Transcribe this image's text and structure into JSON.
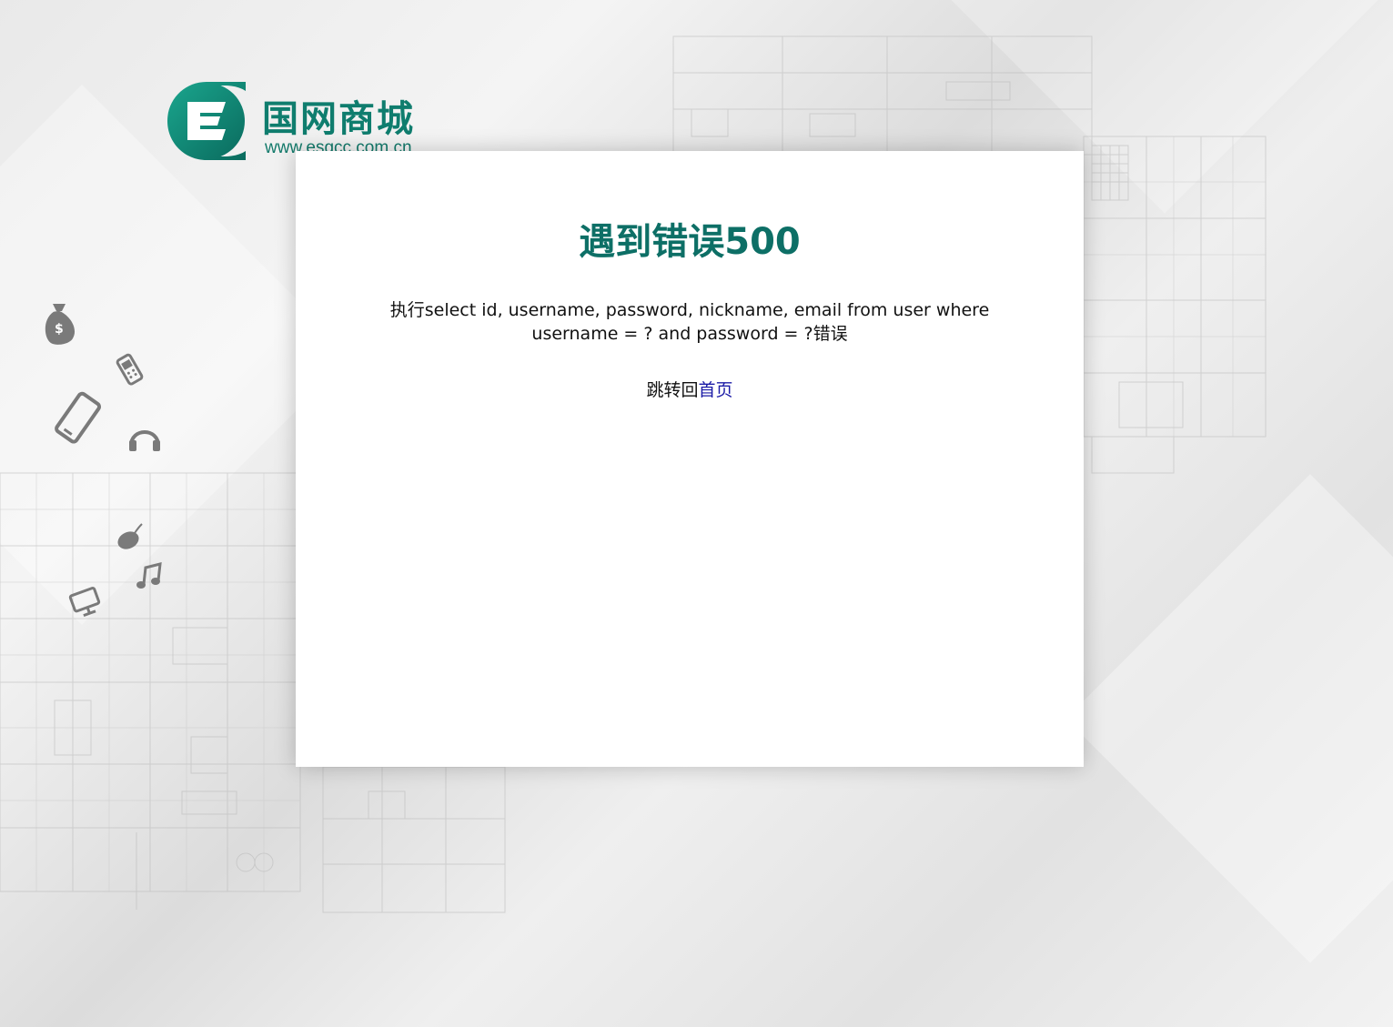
{
  "brand": {
    "name": "国网商城",
    "url": "www.esgcc.com.cn",
    "primary_color": "#0f7d6e"
  },
  "error": {
    "title": "遇到错误500",
    "message": "执行select id, username, password, nickname, email from user where username = ? and password = ?错误"
  },
  "redirect": {
    "prefix": "跳转回",
    "link_label": "首页"
  },
  "decorations": [
    "money-bag-icon",
    "phone-icon",
    "smartphone-icon",
    "headphones-icon",
    "mouse-icon",
    "music-note-icon",
    "monitor-icon"
  ]
}
